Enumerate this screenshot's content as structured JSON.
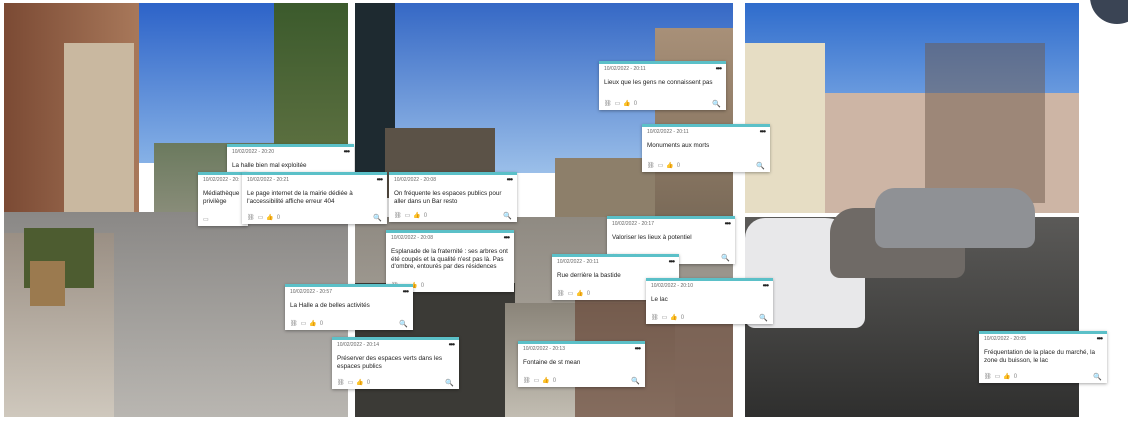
{
  "colors": {
    "note_accent": "#5bc0c8",
    "note_bg": "#ffffff",
    "avatar": "#3a4454"
  },
  "icons": {
    "more": "more-icon",
    "link": "link-icon",
    "image": "image-icon",
    "like": "thumbs-up-icon",
    "zoom": "zoom-icon"
  },
  "note_ui": {
    "more_glyph": "•••",
    "link_glyph": "⛓",
    "image_glyph": "▭",
    "like_glyph": "👍",
    "zoom_glyph": "🔍"
  },
  "notes": [
    {
      "timestamp": "10/02/2022 - 20:11",
      "text": "Lieux que les gens ne connaissent pas",
      "likes": "0"
    },
    {
      "timestamp": "10/02/2022 - 20:11",
      "text": "Monuments aux morts",
      "likes": "0"
    },
    {
      "timestamp": "10/02/2022 - 20:20",
      "text": "La halle bien mal exploitée",
      "likes": "0"
    },
    {
      "timestamp": "10/02/2022 - 20:",
      "text": "Médiathèque privilège",
      "likes": "0"
    },
    {
      "timestamp": "10/02/2022 - 20:21",
      "text": "Le page internet de la mairie dédiée à l'accessibilité affiche erreur 404",
      "likes": "0"
    },
    {
      "timestamp": "10/02/2022 - 20:08",
      "text": "On fréquente les espaces publics pour aller dans un Bar resto",
      "likes": "0"
    },
    {
      "timestamp": "10/02/2022 - 20:17",
      "text": "Valoriser les lieux à potentiel",
      "likes": "0"
    },
    {
      "timestamp": "10/02/2022 - 20:08",
      "text": "Esplanade de la fraternité : ses arbres ont été coupés et la qualité n'est pas là. Pas d'ombre, entourés par des résidences",
      "likes": "0"
    },
    {
      "timestamp": "10/02/2022 - 20:11",
      "text": "Rue derrière la bastide",
      "likes": "0"
    },
    {
      "timestamp": "10/02/2022 - 20:10",
      "text": "Le lac",
      "likes": "0"
    },
    {
      "timestamp": "10/02/2022 - 20:57",
      "text": "La Halle a de belles activités",
      "likes": "0"
    },
    {
      "timestamp": "10/02/2022 - 20:14",
      "text": "Préserver des espaces verts dans les espaces publics",
      "likes": "0"
    },
    {
      "timestamp": "10/02/2022 - 20:13",
      "text": "Fontaine de st mean",
      "likes": "0"
    },
    {
      "timestamp": "10/02/2022 - 20:05",
      "text": "Fréquentation de la place du marché, la zone du buisson, le lac",
      "likes": "0"
    }
  ]
}
